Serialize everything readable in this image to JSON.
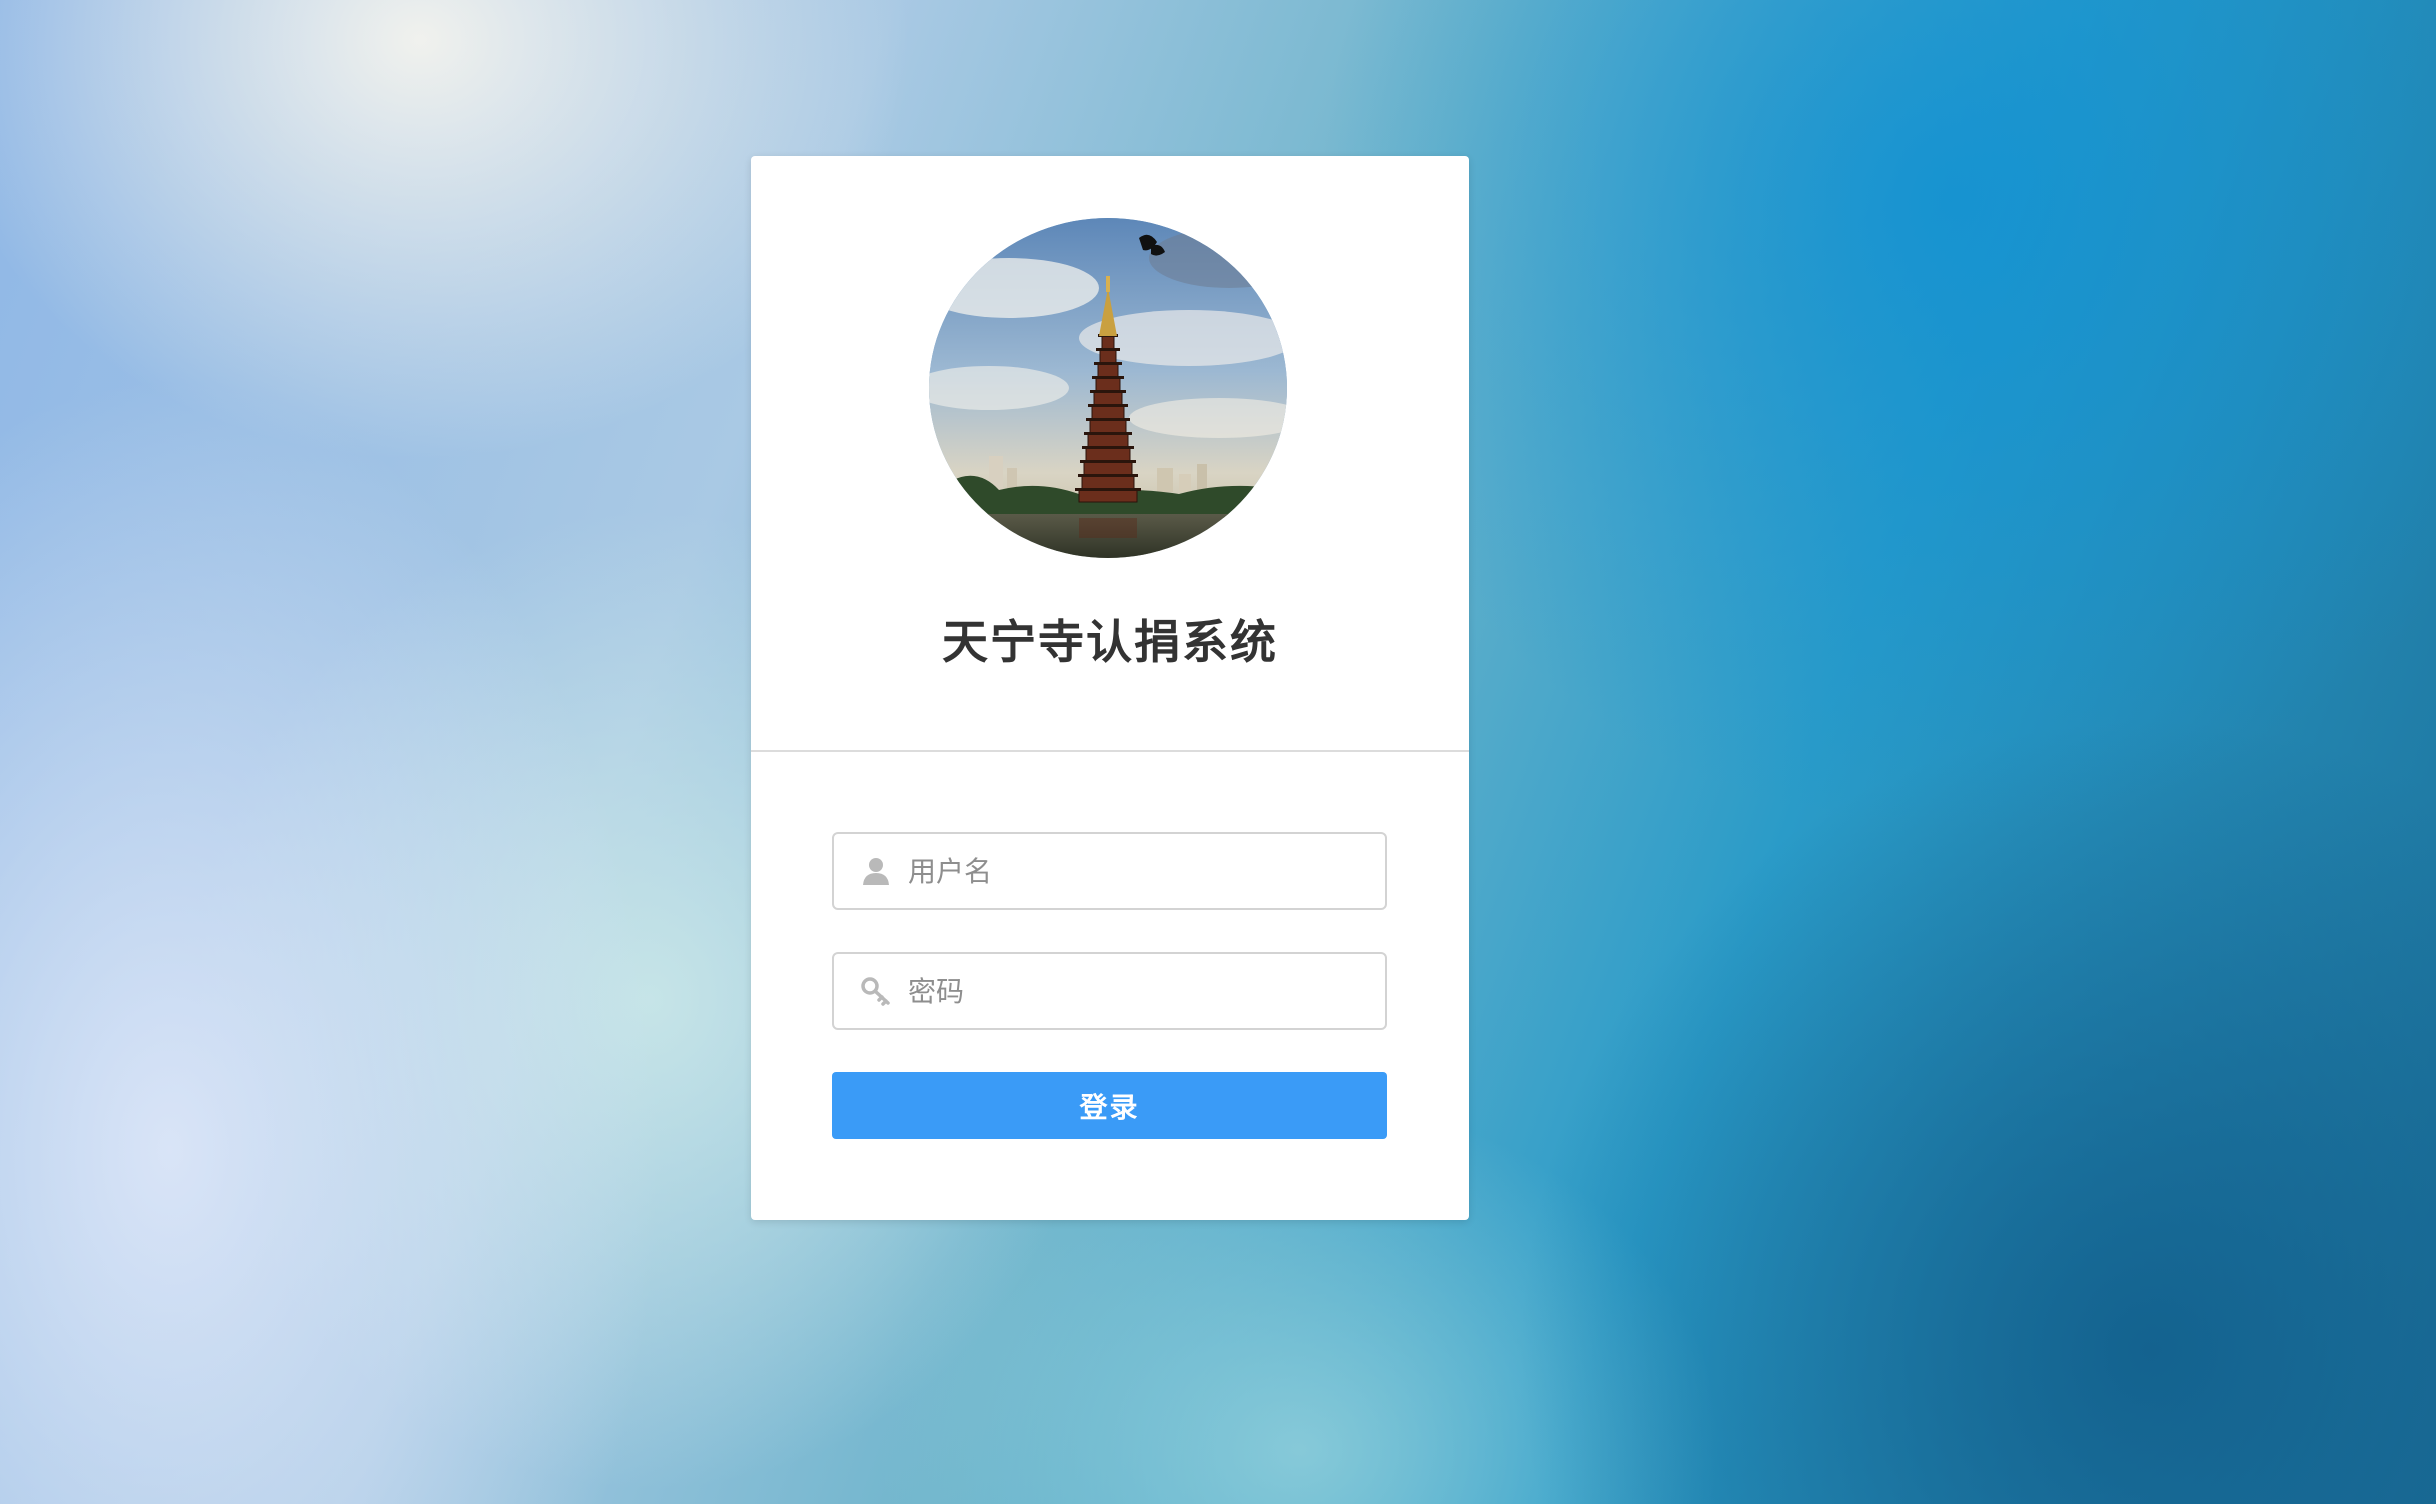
{
  "app": {
    "title": "天宁寺认捐系统"
  },
  "logo": {
    "icon": "pagoda-image"
  },
  "form": {
    "username": {
      "value": "",
      "placeholder": "用户名",
      "icon": "user-icon"
    },
    "password": {
      "value": "",
      "placeholder": "密码",
      "icon": "key-icon"
    },
    "submit_label": "登录"
  },
  "colors": {
    "primary_button": "#3a9bf7",
    "card_background": "#ffffff",
    "title_text": "#333333",
    "placeholder_text": "#8e8e8e",
    "input_border": "#d3d3d3"
  }
}
